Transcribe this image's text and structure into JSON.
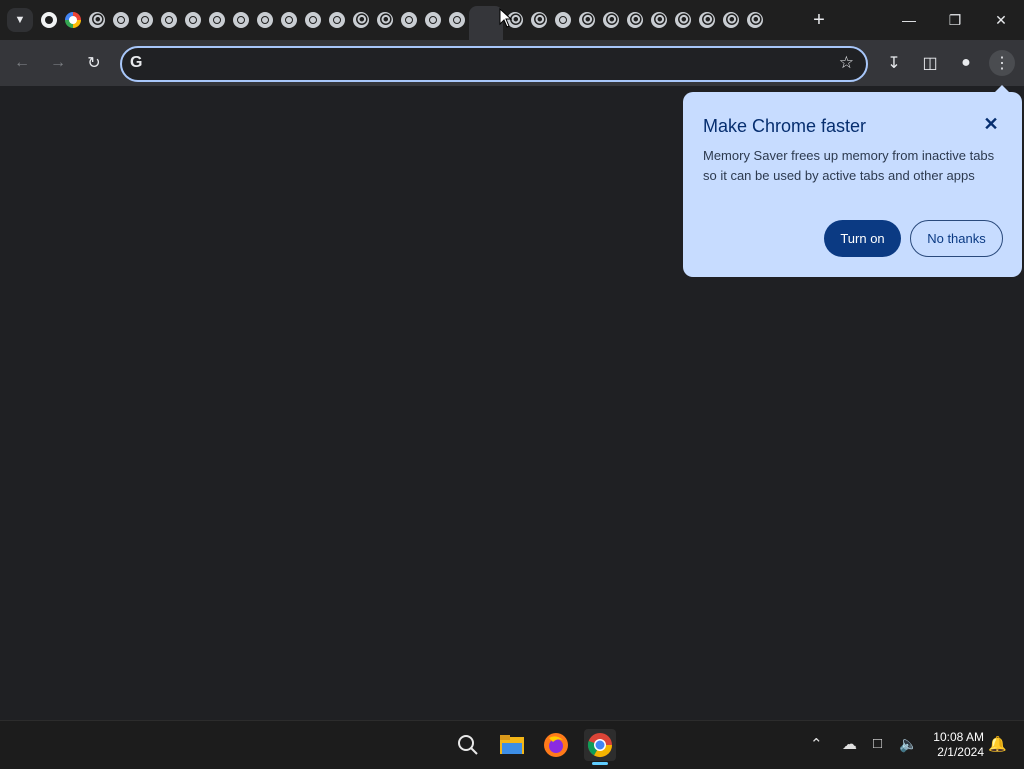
{
  "browser": {
    "tabs": [
      {
        "icon": "github-icon"
      },
      {
        "icon": "google-icon"
      },
      {
        "icon": "swirl-icon"
      },
      {
        "icon": "chrome-icon"
      },
      {
        "icon": "chrome-icon"
      },
      {
        "icon": "chrome-icon"
      },
      {
        "icon": "chrome-icon"
      },
      {
        "icon": "chrome-icon"
      },
      {
        "icon": "chrome-icon"
      },
      {
        "icon": "chrome-icon"
      },
      {
        "icon": "chrome-icon"
      },
      {
        "icon": "chrome-icon"
      },
      {
        "icon": "chrome-icon"
      },
      {
        "icon": "swirl-icon"
      },
      {
        "icon": "swirl-icon"
      },
      {
        "icon": "chrome-icon"
      },
      {
        "icon": "chrome-icon"
      },
      {
        "icon": "chrome-icon"
      },
      {
        "icon": "active-blank-tab"
      },
      {
        "icon": "swirl-icon"
      },
      {
        "icon": "swirl-icon"
      },
      {
        "icon": "chrome-icon"
      },
      {
        "icon": "swirl-icon"
      },
      {
        "icon": "swirl-icon"
      },
      {
        "icon": "swirl-icon"
      },
      {
        "icon": "swirl-icon"
      },
      {
        "icon": "swirl-icon"
      },
      {
        "icon": "swirl-icon"
      },
      {
        "icon": "swirl-icon"
      },
      {
        "icon": "swirl-icon"
      }
    ],
    "omnibox": {
      "value": "",
      "placeholder": ""
    }
  },
  "popup": {
    "title": "Make Chrome faster",
    "body": "Memory Saver frees up memory from inactive tabs so it can be used by active tabs and other apps",
    "turn_on_label": "Turn on",
    "no_thanks_label": "No thanks",
    "colors": {
      "background": "#c7dcff",
      "primary_button": "#0b3a83"
    }
  },
  "taskbar": {
    "apps": [
      "search-icon",
      "file-explorer-icon",
      "firefox-icon",
      "chrome-icon"
    ],
    "time": "10:08 AM",
    "date": "2/1/2024"
  }
}
